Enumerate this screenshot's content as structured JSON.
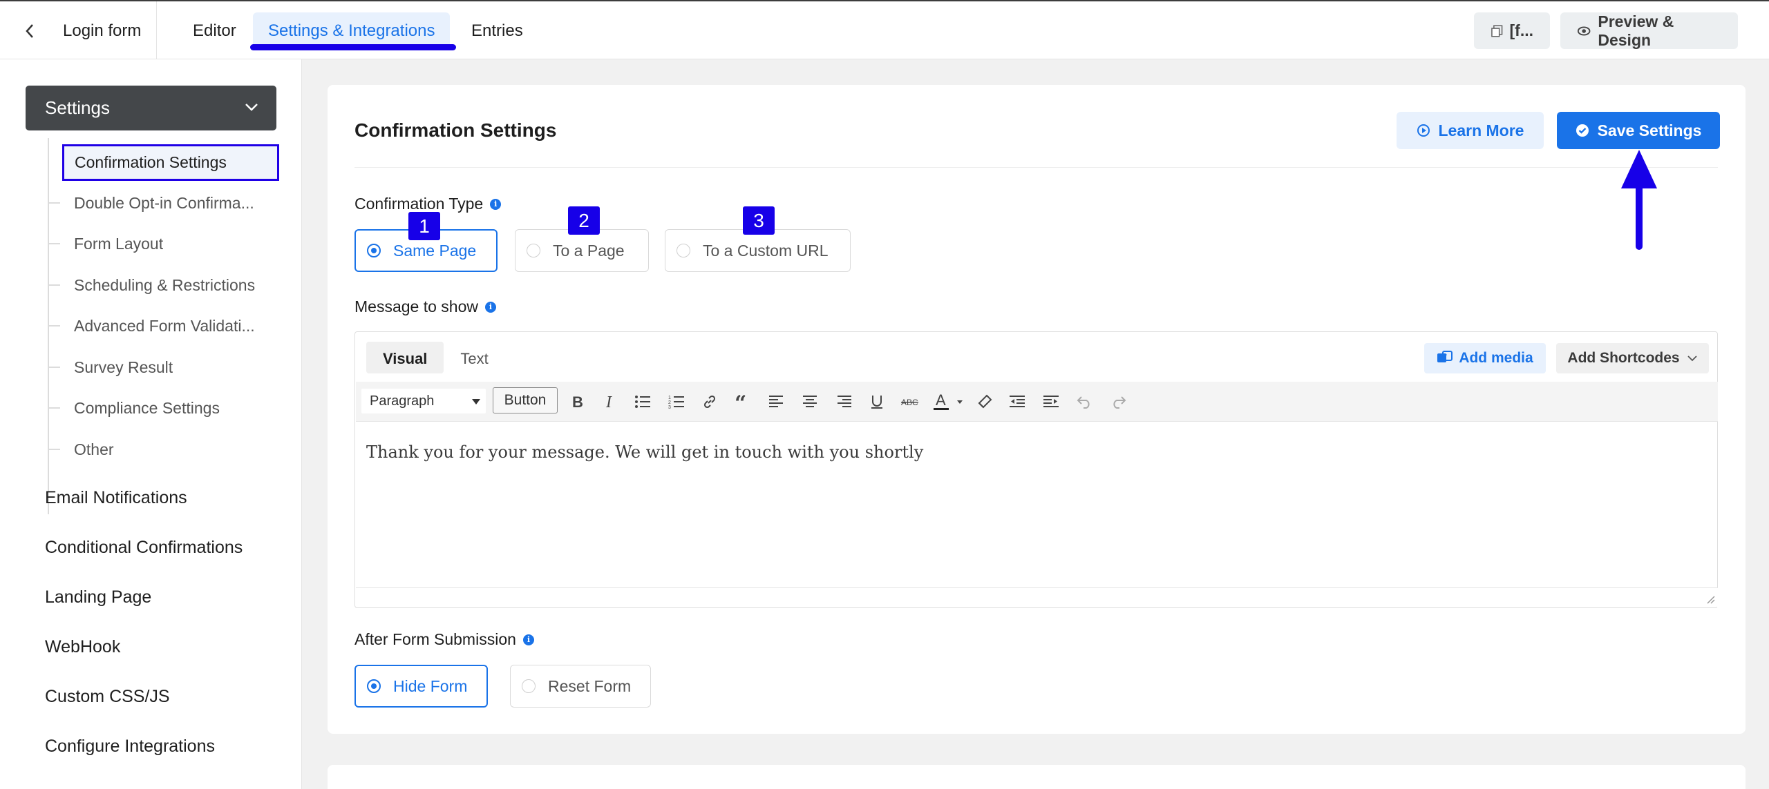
{
  "topbar": {
    "form_title": "Login form",
    "tabs": {
      "editor": "Editor",
      "settings": "Settings & Integrations",
      "entries": "Entries"
    },
    "shortcode_btn": "[f...",
    "preview_btn": "Preview & Design"
  },
  "sidebar": {
    "header": "Settings",
    "sub_items": [
      "Confirmation Settings",
      "Double Opt-in Confirma...",
      "Form Layout",
      "Scheduling & Restrictions",
      "Advanced Form Validati...",
      "Survey Result",
      "Compliance Settings",
      "Other"
    ],
    "main_items": [
      "Email Notifications",
      "Conditional Confirmations",
      "Landing Page",
      "WebHook",
      "Custom CSS/JS",
      "Configure Integrations"
    ]
  },
  "card": {
    "title": "Confirmation Settings",
    "learn_more": "Learn More",
    "save_settings": "Save Settings",
    "confirmation_type_label": "Confirmation Type",
    "confirmation_options": [
      "Same Page",
      "To a Page",
      "To a Custom URL"
    ],
    "selected_confirmation": "Same Page",
    "message_label": "Message to show",
    "after_submission_label": "After Form Submission",
    "after_options": [
      "Hide Form",
      "Reset Form"
    ],
    "selected_after": "Hide Form"
  },
  "annotations": {
    "badges": [
      "1",
      "2",
      "3"
    ]
  },
  "editor": {
    "tabs": [
      "Visual",
      "Text"
    ],
    "add_media": "Add media",
    "add_shortcodes": "Add Shortcodes",
    "format_select": "Paragraph",
    "button_label": "Button",
    "body_text": "Thank you for your message. We will get in touch with you shortly"
  },
  "colors": {
    "accent": "#1a73e8",
    "annotation": "#1700e8",
    "sidebar_header": "#44474a"
  }
}
